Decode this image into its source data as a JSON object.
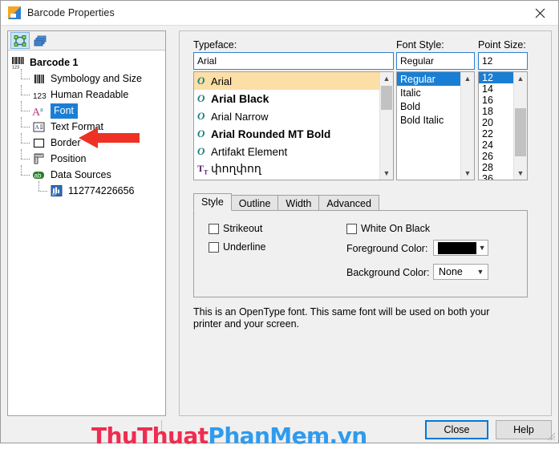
{
  "window": {
    "title": "Barcode Properties",
    "icon": "barcode-app-icon",
    "close_label": "✕"
  },
  "sidebar": {
    "toolbar": [
      {
        "name": "select-nodes-icon",
        "pressed": true
      },
      {
        "name": "layers-icon",
        "pressed": false
      }
    ],
    "tree": [
      {
        "label": "Barcode 1",
        "icon": "barcode-icon",
        "level": 0,
        "bold": true,
        "selected": false
      },
      {
        "label": "Symbology and Size",
        "icon": "barcode-bars-icon",
        "level": 1,
        "bold": false,
        "selected": false
      },
      {
        "label": "Human Readable",
        "icon": "digits-123-icon",
        "level": 1,
        "bold": false,
        "selected": false
      },
      {
        "label": "Font",
        "icon": "font-A-icon",
        "level": 1,
        "bold": false,
        "selected": true
      },
      {
        "label": "Text Format",
        "icon": "text-format-icon",
        "level": 1,
        "bold": false,
        "selected": false
      },
      {
        "label": "Border",
        "icon": "border-square-icon",
        "level": 1,
        "bold": false,
        "selected": false
      },
      {
        "label": "Position",
        "icon": "ruler-position-icon",
        "level": 1,
        "bold": false,
        "selected": false
      },
      {
        "label": "Data Sources",
        "icon": "abc-data-icon",
        "level": 1,
        "bold": false,
        "selected": false
      },
      {
        "label": "112774226656",
        "icon": "data-field-icon",
        "level": 2,
        "bold": false,
        "selected": false
      }
    ],
    "annotation": {
      "name": "red-arrow-pointer",
      "color": "#ee3124",
      "points_to": "Font"
    }
  },
  "font_dialog": {
    "typeface": {
      "label": "Typeface:",
      "value": "Arial",
      "items": [
        {
          "name": "Arial",
          "type": "O",
          "style": "normal",
          "selected": true
        },
        {
          "name": "Arial Black",
          "type": "O",
          "style": "black",
          "selected": false
        },
        {
          "name": "Arial Narrow",
          "type": "O",
          "style": "narrow",
          "selected": false
        },
        {
          "name": "Arial Rounded MT Bold",
          "type": "O",
          "style": "rounded",
          "selected": false
        },
        {
          "name": "Artifakt Element",
          "type": "O",
          "style": "artifakt",
          "selected": false
        },
        {
          "name": "փողփող",
          "type": "TT",
          "style": "symbol",
          "selected": false
        }
      ]
    },
    "font_style": {
      "label": "Font Style:",
      "value": "Regular",
      "items": [
        "Regular",
        "Italic",
        "Bold",
        "Bold Italic"
      ],
      "selected_index": 0
    },
    "point_size": {
      "label": "Point Size:",
      "value": "12",
      "items": [
        "12",
        "14",
        "16",
        "18",
        "20",
        "22",
        "24",
        "26",
        "28",
        "36"
      ],
      "selected_index": 0
    },
    "tabs": [
      {
        "label": "Style",
        "active": true
      },
      {
        "label": "Outline",
        "active": false
      },
      {
        "label": "Width",
        "active": false
      },
      {
        "label": "Advanced",
        "active": false
      }
    ],
    "style_tab": {
      "strikeout": {
        "label": "Strikeout",
        "checked": false
      },
      "underline": {
        "label": "Underline",
        "checked": false
      },
      "white_on_black": {
        "label": "White On Black",
        "checked": false
      },
      "foreground_color": {
        "label": "Foreground Color:",
        "value": "",
        "swatch": "#000000"
      },
      "background_color": {
        "label": "Background Color:",
        "value": "None"
      }
    },
    "description": "This is an OpenType font. This same font will be used on both your printer and your screen."
  },
  "footer": {
    "close_button": "Close",
    "help_button": "Help"
  },
  "watermark": {
    "part1": "ThuThuat",
    "part2": "PhanMem.vn",
    "color1": "#ef2c4f",
    "color2": "#2f9bee"
  }
}
